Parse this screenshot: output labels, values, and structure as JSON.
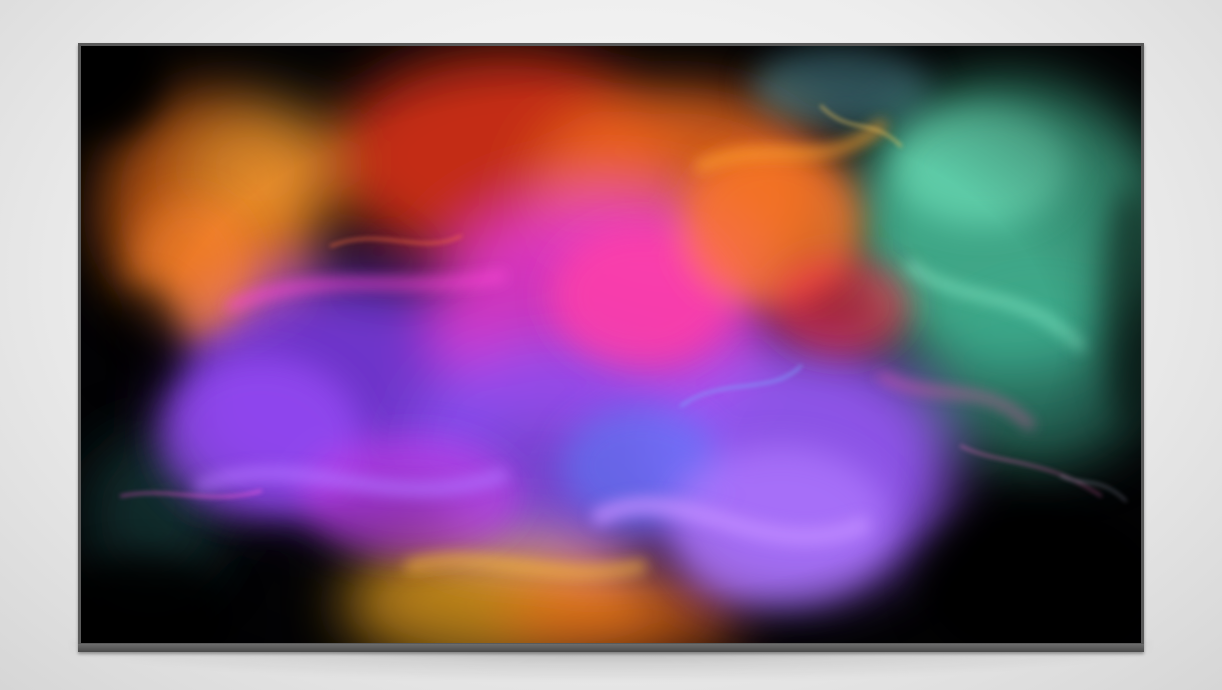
{
  "scene": {
    "subject": "tv-display",
    "screen_content": "colorful-smoke-explosion",
    "colors": {
      "background": "#ececec",
      "bezel": "#5a5a5a",
      "screen_black": "#050508",
      "orange": "#f06a1c",
      "amber": "#f2a020",
      "magenta": "#e43cd8",
      "purple": "#8a4cf0",
      "violet": "#a060ff",
      "blue": "#5a8cf5",
      "teal": "#5ee0b8",
      "red": "#e5304a",
      "yellow": "#f0c020"
    }
  }
}
